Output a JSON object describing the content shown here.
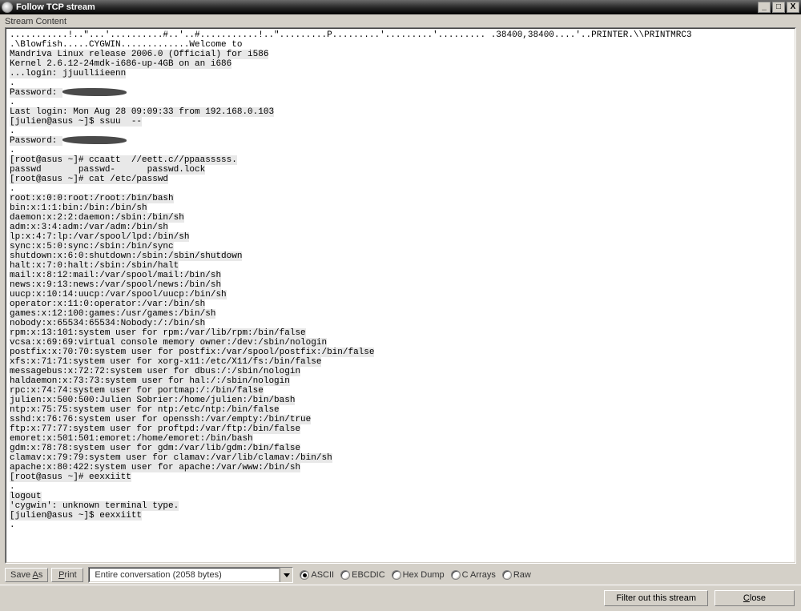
{
  "window": {
    "title": "Follow TCP stream",
    "minimize": "_",
    "maximize": "□",
    "close": "X"
  },
  "panel_label": "Stream Content",
  "stream": {
    "line01": "...........!..\"...'..........#..'..#...........!..\".........P.........'.........'......... .38400,38400....'..PRINTER.\\\\PRINTMRC3",
    "line02": ".\\Blowfish.....CYGWIN.............Welcome to",
    "line03": "Mandriva Linux release 2006.0 (Official) for i586",
    "line04": "Kernel 2.6.12-24mdk-i686-up-4GB on an i686",
    "line05": "...login: jjuulliieenn",
    "line06_label": "Password: ",
    "line07": "Last login: Mon Aug 28 09:09:33 from 192.168.0.103",
    "line08": "[julien@asus ~]$ ssuu  --",
    "line09_label": "Password: ",
    "line10": "[root@asus ~]# ccaatt  //eett.c//ppaasssss.",
    "line11": "passwd       passwd-      passwd.lock",
    "line12": "[root@asus ~]# cat /etc/passwd",
    "p01": "root:x:0:0:root:/root:/bin/bash",
    "p02": "bin:x:1:1:bin:/bin:/bin/sh",
    "p03": "daemon:x:2:2:daemon:/sbin:/bin/sh",
    "p04": "adm:x:3:4:adm:/var/adm:/bin/sh",
    "p05": "lp:x:4:7:lp:/var/spool/lpd:/bin/sh",
    "p06": "sync:x:5:0:sync:/sbin:/bin/sync",
    "p07": "shutdown:x:6:0:shutdown:/sbin:/sbin/shutdown",
    "p08": "halt:x:7:0:halt:/sbin:/sbin/halt",
    "p09": "mail:x:8:12:mail:/var/spool/mail:/bin/sh",
    "p10": "news:x:9:13:news:/var/spool/news:/bin/sh",
    "p11": "uucp:x:10:14:uucp:/var/spool/uucp:/bin/sh",
    "p12": "operator:x:11:0:operator:/var:/bin/sh",
    "p13": "games:x:12:100:games:/usr/games:/bin/sh",
    "p14": "nobody:x:65534:65534:Nobody:/:/bin/sh",
    "p15": "rpm:x:13:101:system user for rpm:/var/lib/rpm:/bin/false",
    "p16": "vcsa:x:69:69:virtual console memory owner:/dev:/sbin/nologin",
    "p17": "postfix:x:70:70:system user for postfix:/var/spool/postfix:/bin/false",
    "p18": "xfs:x:71:71:system user for xorg-x11:/etc/X11/fs:/bin/false",
    "p19": "messagebus:x:72:72:system user for dbus:/:/sbin/nologin",
    "p20": "haldaemon:x:73:73:system user for hal:/:/sbin/nologin",
    "p21": "rpc:x:74:74:system user for portmap:/:/bin/false",
    "p22": "julien:x:500:500:Julien Sobrier:/home/julien:/bin/bash",
    "p23": "ntp:x:75:75:system user for ntp:/etc/ntp:/bin/false",
    "p24": "sshd:x:76:76:system user for openssh:/var/empty:/bin/true",
    "p25": "ftp:x:77:77:system user for proftpd:/var/ftp:/bin/false",
    "p26": "emoret:x:501:501:emoret:/home/emoret:/bin/bash",
    "p27": "gdm:x:78:78:system user for gdm:/var/lib/gdm:/bin/false",
    "p28": "clamav:x:79:79:system user for clamav:/var/lib/clamav:/bin/sh",
    "p29": "apache:x:80:422:system user for apache:/var/www:/bin/sh",
    "line13": "[root@asus ~]# eexxiitt",
    "line14": "logout",
    "line15": "'cygwin': unknown terminal type.",
    "line16": "[julien@asus ~]$ eexxiitt"
  },
  "bottom": {
    "save_as": "Save As",
    "print": "Print",
    "combo": "Entire conversation (2058 bytes)",
    "radios": [
      "ASCII",
      "EBCDIC",
      "Hex Dump",
      "C Arrays",
      "Raw"
    ],
    "selected": 0
  },
  "footer": {
    "filter": "Filter out this stream",
    "close": "Close"
  }
}
